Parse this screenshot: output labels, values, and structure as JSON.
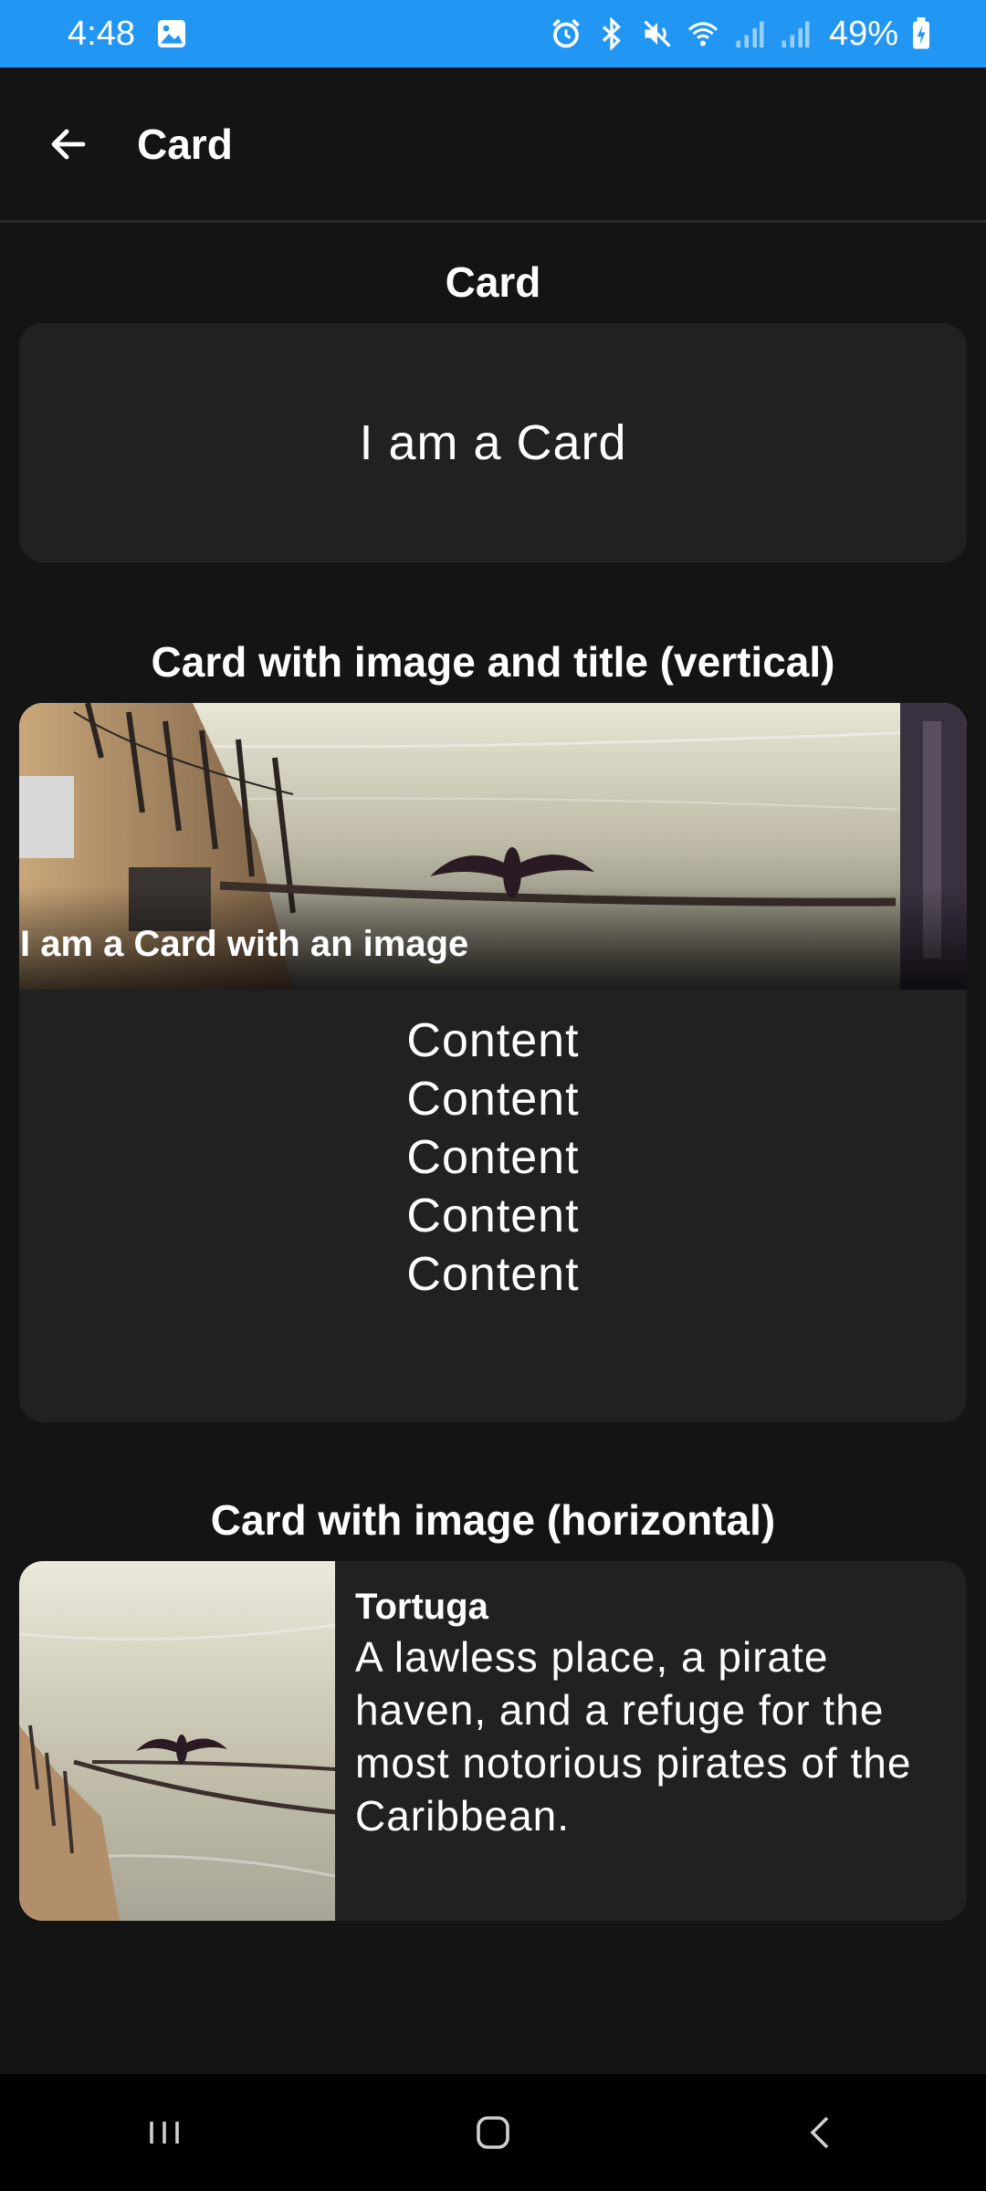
{
  "status_bar": {
    "time": "4:48",
    "battery": "49%",
    "icons": [
      "gallery-icon",
      "alarm-icon",
      "bluetooth-icon",
      "mute-icon",
      "wifi-icon",
      "signal-icon",
      "signal-icon",
      "battery-charging-icon"
    ],
    "background_color": "#2196f3"
  },
  "app_bar": {
    "title": "Card",
    "back_icon": "arrow-left-icon"
  },
  "sections": {
    "card": {
      "title": "Card",
      "card_text": "I am a Card"
    },
    "vertical": {
      "title": "Card with image and title (vertical)",
      "image_title": "I am a Card with an image",
      "content_lines": [
        "Content",
        "Content",
        "Content",
        "Content",
        "Content"
      ]
    },
    "horizontal": {
      "title": "Card with image (horizontal)",
      "card_title": "Tortuga",
      "card_description": "A lawless place, a pirate haven, and a refuge for the most notorious pirates of the Caribbean."
    }
  },
  "nav_bar": {
    "buttons": [
      "recent-apps-icon",
      "home-icon",
      "back-icon"
    ]
  },
  "colors": {
    "background": "#141414",
    "card": "#212121",
    "text": "#ffffff"
  }
}
